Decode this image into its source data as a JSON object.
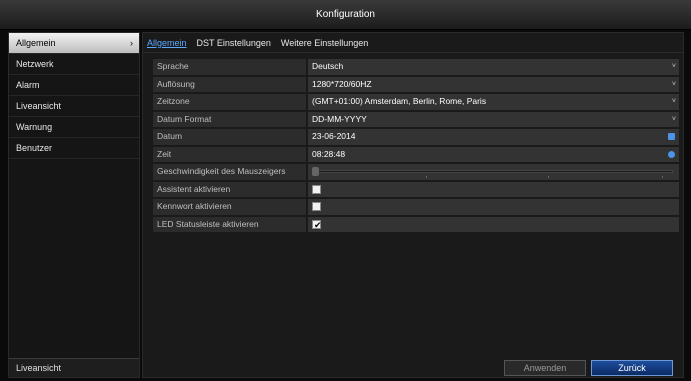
{
  "window": {
    "title": "Konfiguration"
  },
  "sidebar": {
    "items": [
      {
        "label": "Allgemein",
        "active": true
      },
      {
        "label": "Netzwerk"
      },
      {
        "label": "Alarm"
      },
      {
        "label": "Liveansicht"
      },
      {
        "label": "Warnung"
      },
      {
        "label": "Benutzer"
      }
    ],
    "bottom_label": "Liveansicht"
  },
  "tabs": [
    {
      "label": "Allgemein",
      "active": true
    },
    {
      "label": "DST Einstellungen"
    },
    {
      "label": "Weitere Einstellungen"
    }
  ],
  "form": {
    "sprache": {
      "label": "Sprache",
      "value": "Deutsch"
    },
    "aufloesung": {
      "label": "Auflösung",
      "value": "1280*720/60HZ"
    },
    "zeitzone": {
      "label": "Zeitzone",
      "value": "(GMT+01:00) Amsterdam, Berlin, Rome, Paris"
    },
    "datum_format": {
      "label": "Datum Format",
      "value": "DD-MM-YYYY"
    },
    "datum": {
      "label": "Datum",
      "value": "23-06-2014"
    },
    "zeit": {
      "label": "Zeit",
      "value": "08:28:48"
    },
    "maus": {
      "label": "Geschwindigkeit des Mauszeigers",
      "level": 0.0
    },
    "assistent": {
      "label": "Assistent aktivieren",
      "checked": false
    },
    "kennwort": {
      "label": "Kennwort aktivieren",
      "checked": false
    },
    "led": {
      "label": "LED Statusleiste aktivieren",
      "checked": true
    }
  },
  "buttons": {
    "apply": "Anwenden",
    "back": "Zurück"
  },
  "colors": {
    "accent": "#5aa9ff",
    "back_button": "#1e4d9c"
  }
}
